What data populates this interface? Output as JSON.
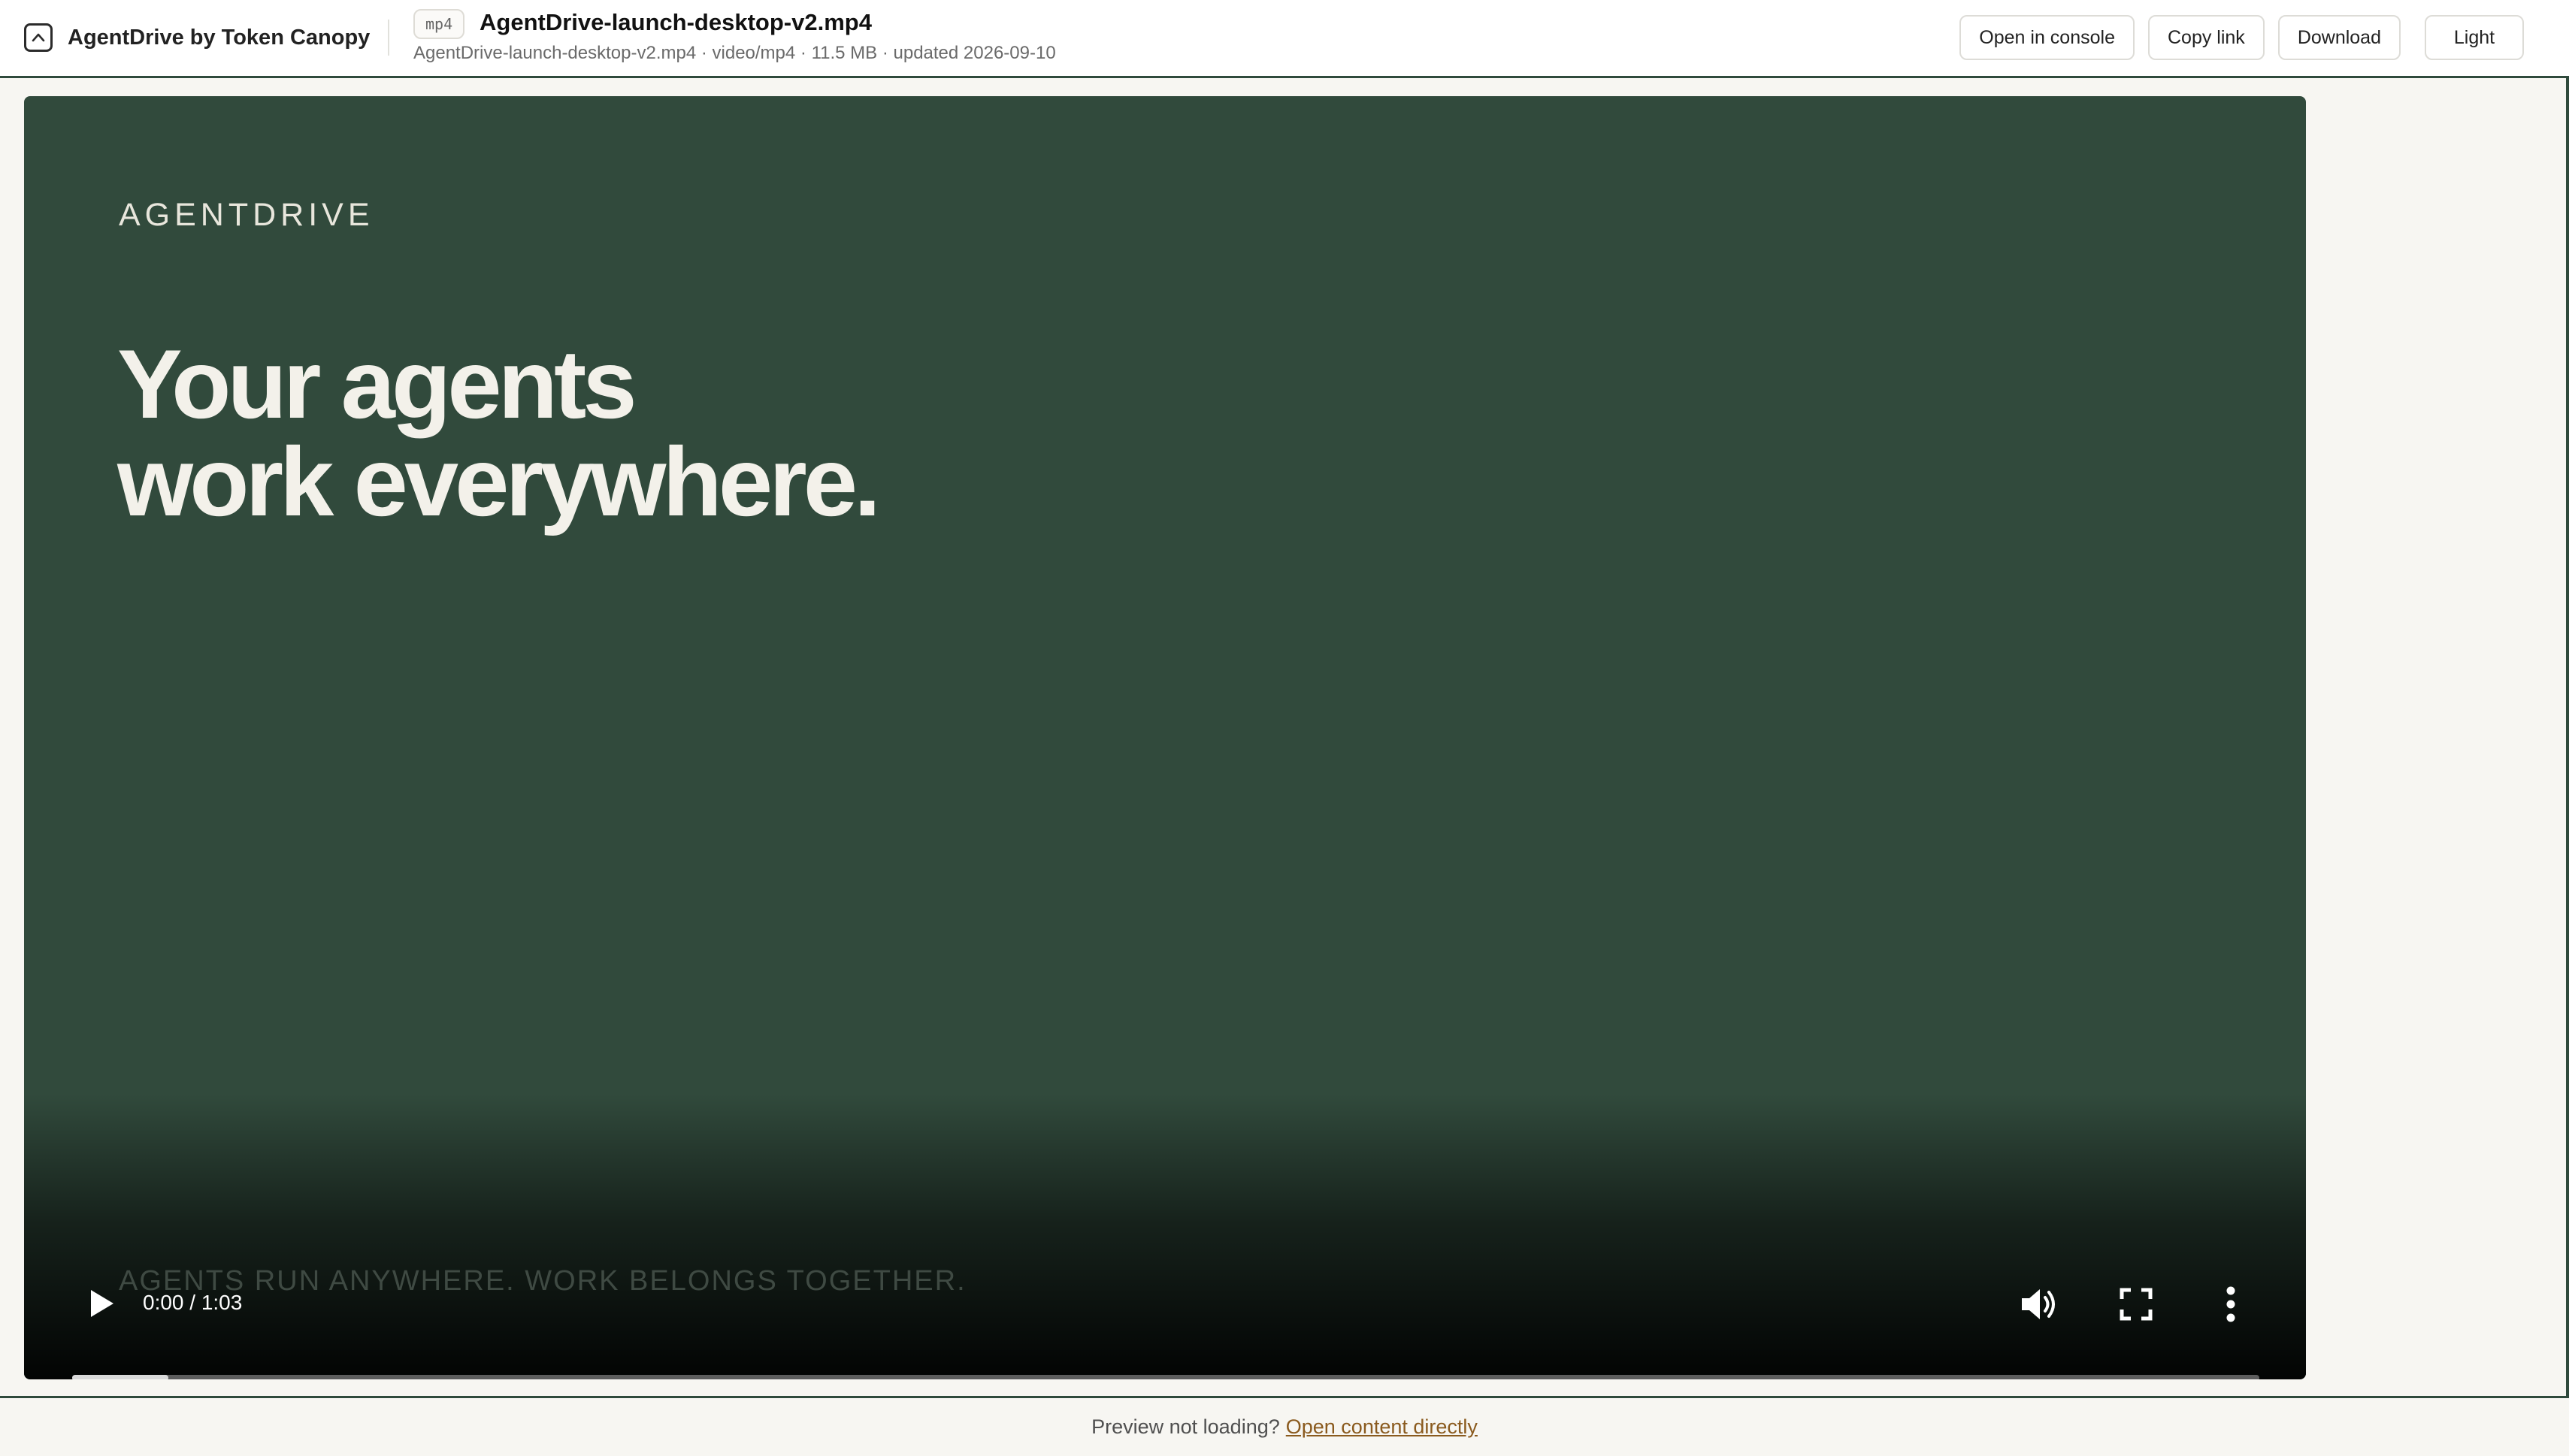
{
  "header": {
    "brand_name": "AgentDrive by Token Canopy",
    "logo_icon": "chevron-up-box-icon",
    "file_type_tag": "mp4",
    "file_title": "AgentDrive-launch-desktop-v2.mp4",
    "file_meta": "AgentDrive-launch-desktop-v2.mp4 · video/mp4 · 11.5 MB · updated 2026-09-10",
    "actions": {
      "open_console": "Open in console",
      "copy_link": "Copy link",
      "download": "Download",
      "theme": "Light"
    }
  },
  "video": {
    "frame_brand": "AGENTDRIVE",
    "headline_line1": "Your agents",
    "headline_line2": "work everywhere.",
    "tagline": "AGENTS RUN ANYWHERE. WORK BELONGS TOGETHER.",
    "background_color": "#314a3c",
    "controls": {
      "time": "0:00 / 1:03",
      "played_fraction": 0.044,
      "play_icon": "play-icon",
      "volume_icon": "volume-icon",
      "fullscreen_icon": "fullscreen-icon",
      "more_icon": "more-vertical-icon"
    }
  },
  "footer": {
    "prompt": "Preview not loading?",
    "link": "Open content directly"
  },
  "colors": {
    "accent": "#2f4a3c",
    "link": "#8a5a1e",
    "page_background": "#f7f6f2"
  }
}
